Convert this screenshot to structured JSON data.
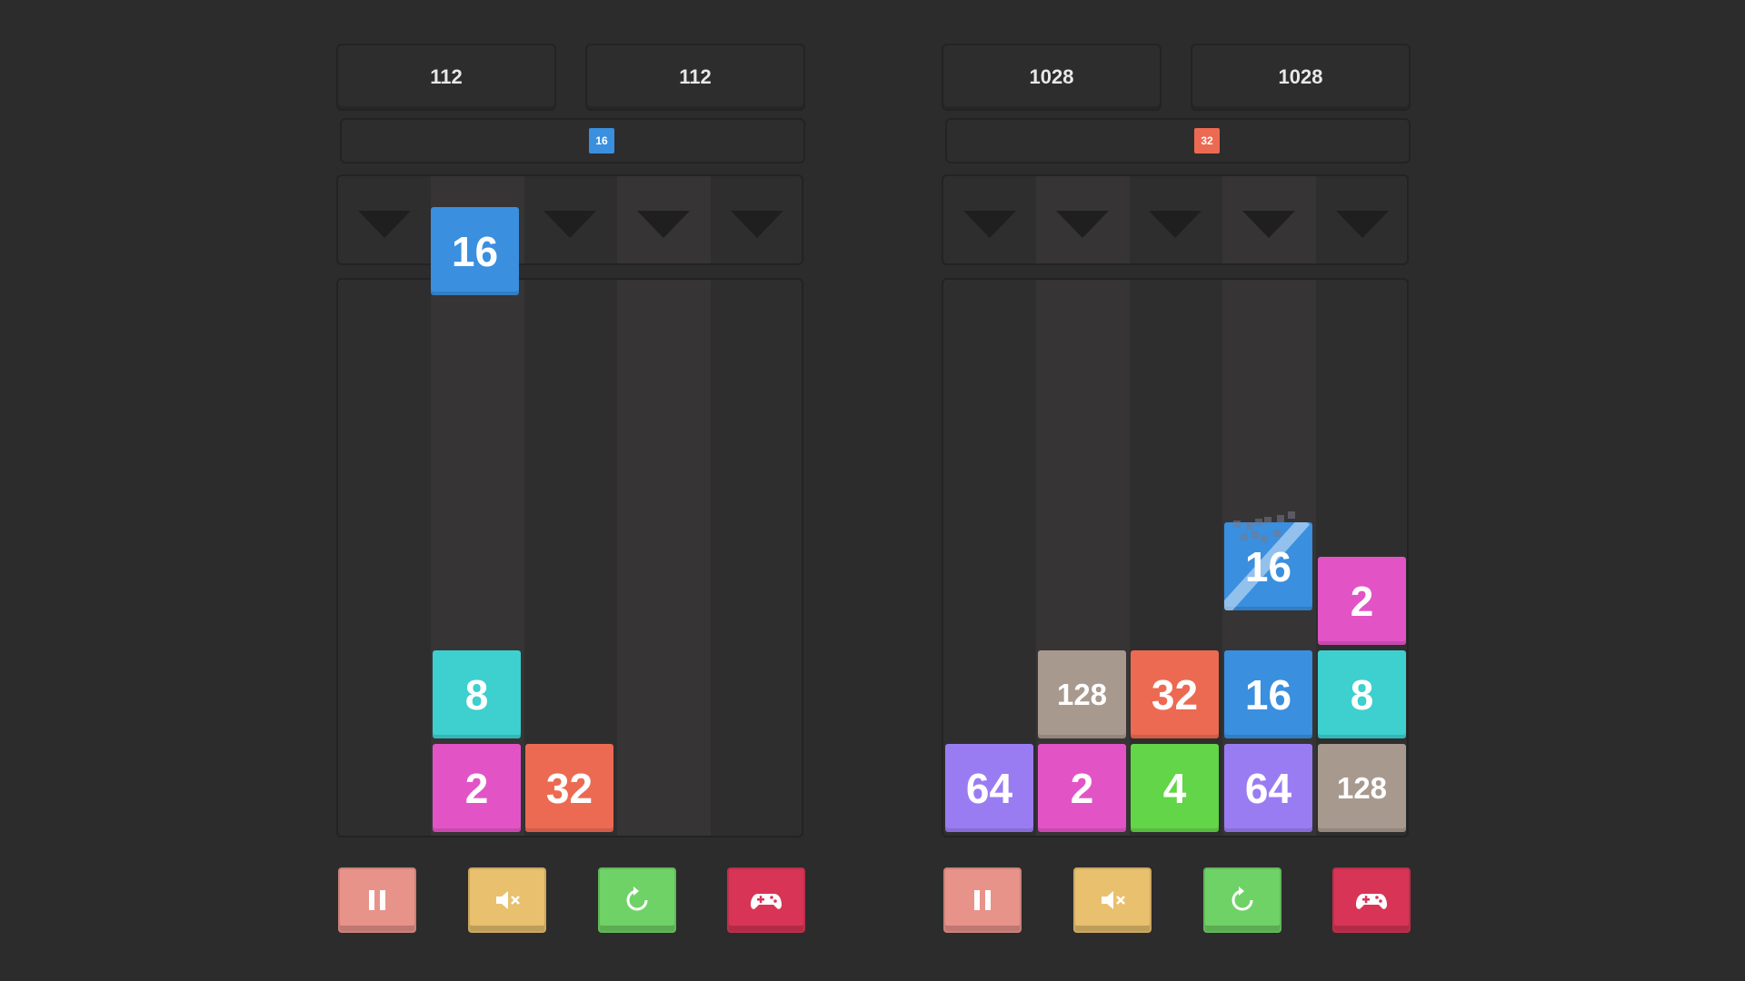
{
  "colors": {
    "2": "#e254c6",
    "4": "#62d548",
    "8": "#3ecfcf",
    "16": "#3a8fde",
    "32": "#ec6a52",
    "64": "#9a7cf2",
    "128": "#a8998f",
    "pause": "#e8938a",
    "sound": "#e8c06e",
    "restart": "#6fd266",
    "games": "#d83556"
  },
  "boards": [
    {
      "score_left": "112",
      "score_right": "112",
      "next": "16",
      "highlight_cols": [
        1,
        3
      ],
      "falling": {
        "col": 1,
        "value": "16"
      },
      "tiles": [
        {
          "col": 1,
          "row": 0,
          "value": "2"
        },
        {
          "col": 2,
          "row": 0,
          "value": "32"
        },
        {
          "col": 1,
          "row": 1,
          "value": "8"
        }
      ],
      "merging": null,
      "controls": {
        "pause_icon": "pause-icon",
        "sound_icon": "mute-icon",
        "restart_icon": "restart-icon",
        "games_icon": "gamepad-icon"
      }
    },
    {
      "score_left": "1028",
      "score_right": "1028",
      "next": "32",
      "highlight_cols": [
        1,
        3
      ],
      "falling": null,
      "tiles": [
        {
          "col": 0,
          "row": 0,
          "value": "64"
        },
        {
          "col": 1,
          "row": 0,
          "value": "2"
        },
        {
          "col": 2,
          "row": 0,
          "value": "4"
        },
        {
          "col": 3,
          "row": 0,
          "value": "64"
        },
        {
          "col": 4,
          "row": 0,
          "value": "128"
        },
        {
          "col": 1,
          "row": 1,
          "value": "128"
        },
        {
          "col": 2,
          "row": 1,
          "value": "32"
        },
        {
          "col": 3,
          "row": 1,
          "value": "16"
        },
        {
          "col": 4,
          "row": 1,
          "value": "8"
        },
        {
          "col": 4,
          "row": 2,
          "value": "2"
        }
      ],
      "merging": {
        "col": 3,
        "value": "16"
      },
      "controls": {
        "pause_icon": "pause-icon",
        "sound_icon": "mute-icon",
        "restart_icon": "restart-icon",
        "games_icon": "gamepad-icon"
      }
    }
  ]
}
